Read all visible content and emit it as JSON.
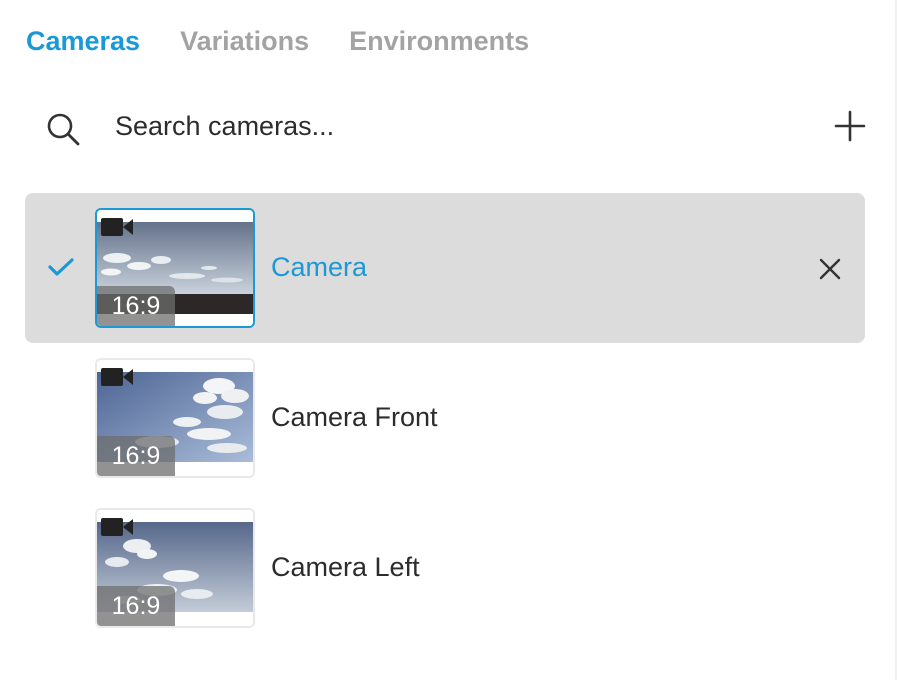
{
  "tabs": [
    {
      "label": "Cameras",
      "active": true
    },
    {
      "label": "Variations",
      "active": false
    },
    {
      "label": "Environments",
      "active": false
    }
  ],
  "search": {
    "placeholder": "Search cameras...",
    "value": "",
    "icon": "search-icon"
  },
  "add_icon": "plus-icon",
  "cameras": [
    {
      "name": "Camera",
      "aspect": "16:9",
      "selected": true,
      "icon": "video-camera-icon"
    },
    {
      "name": "Camera Front",
      "aspect": "16:9",
      "selected": false,
      "icon": "video-camera-icon"
    },
    {
      "name": "Camera Left",
      "aspect": "16:9",
      "selected": false,
      "icon": "video-camera-icon"
    }
  ],
  "colors": {
    "accent": "#1b98d6",
    "selected_row": "#dcdcdc",
    "text": "#2c2c2c",
    "inactive_tab": "#a3a3a3"
  }
}
